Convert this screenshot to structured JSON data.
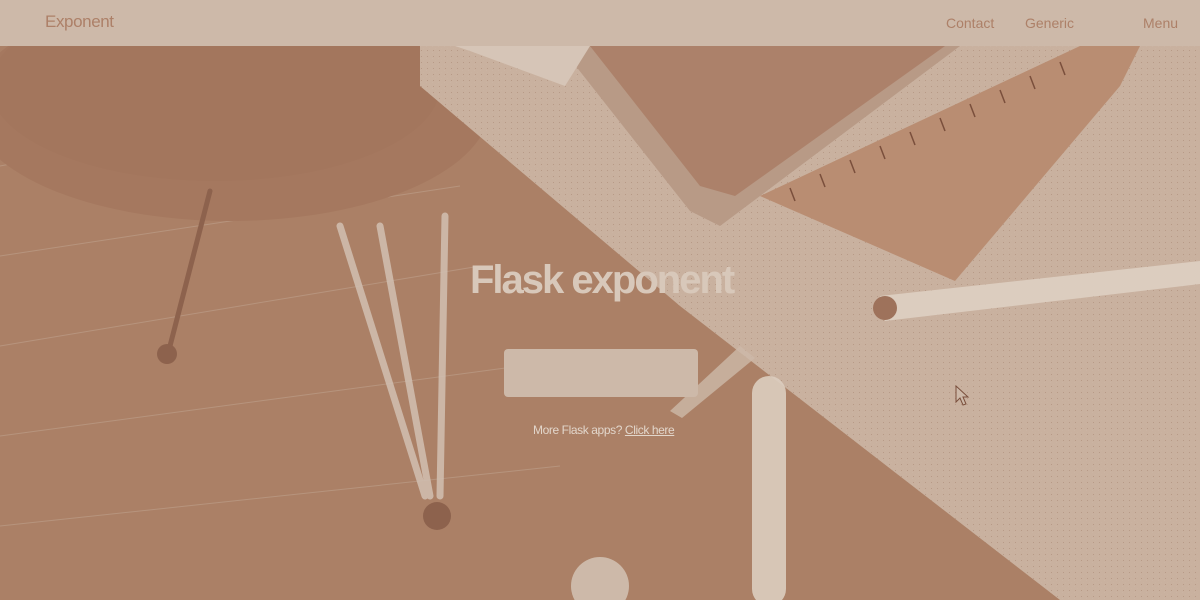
{
  "header": {
    "brand": "Exponent",
    "nav": [
      {
        "label": "Contact"
      },
      {
        "label": "Generic"
      },
      {
        "label": "Menu"
      }
    ]
  },
  "hero": {
    "title": "Flask exponent",
    "button_label": "",
    "more_text": "More Flask apps?",
    "more_link": "Click here"
  },
  "icons": {
    "scroll": "chevron-down-icon",
    "cursor": "mouse-pointer-icon"
  },
  "colors": {
    "header_bg": "#cdb9a9",
    "brand_text": "#ad8068",
    "hero_overlay": "#ab8066",
    "hero_light": "#cdb9a9",
    "title_text": "#d8c8ba"
  }
}
